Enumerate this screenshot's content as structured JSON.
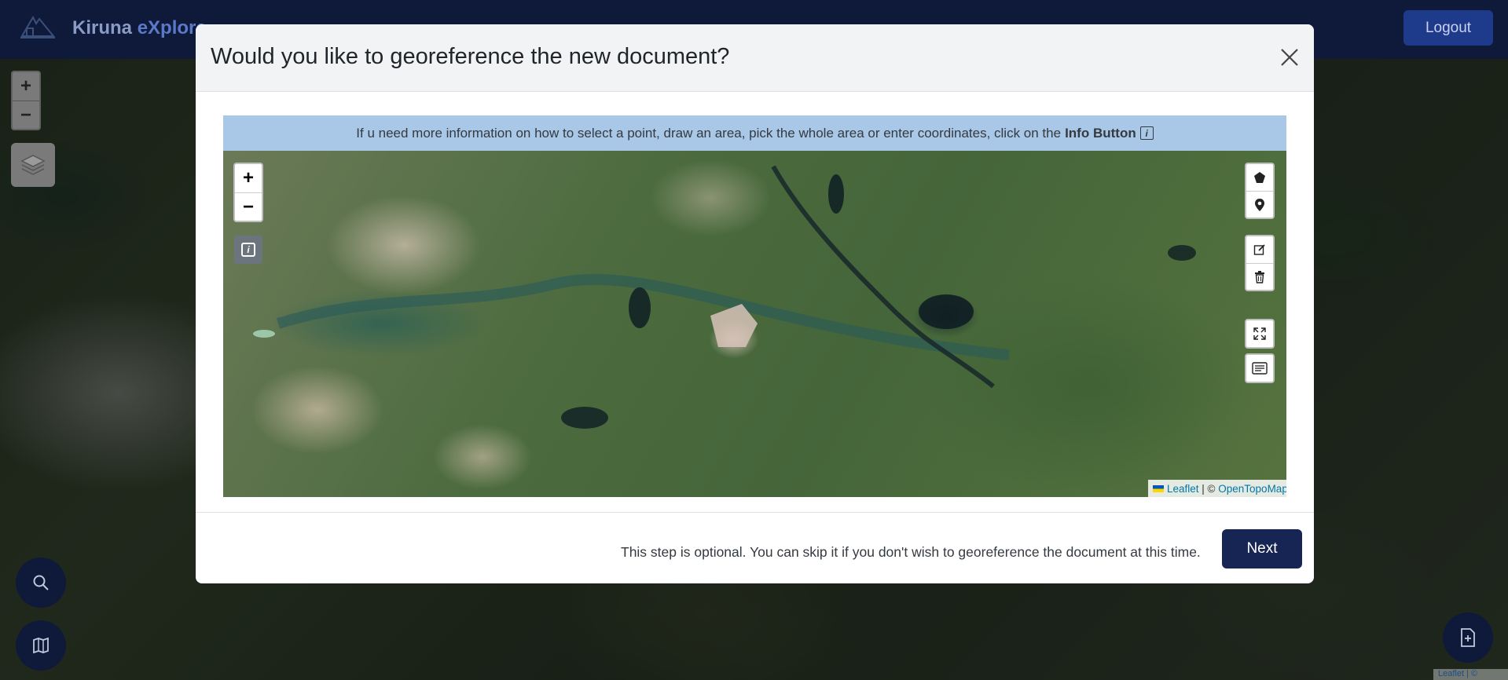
{
  "navbar": {
    "brand_part1": "Kiruna ",
    "brand_part2": "eXplore",
    "logout_label": "Logout"
  },
  "background_map": {
    "zoom_in_label": "+",
    "zoom_out_label": "−",
    "attribution": "Leaflet | ©"
  },
  "modal": {
    "title": "Would you like to georeference the new document?",
    "info_text": "If u need more information on how to select a point, draw an area, pick the whole area or enter coordinates, click on the",
    "info_bold": "Info Button",
    "info_icon_glyph": "i",
    "map": {
      "zoom_in_label": "+",
      "zoom_out_label": "−",
      "info_icon_glyph": "i",
      "attribution_leaflet": "Leaflet",
      "attribution_sep": " | © ",
      "attribution_source": "OpenTopoMap"
    },
    "footer_note": "This step is optional. You can skip it if you don't wish to georeference the document at this time.",
    "next_label": "Next"
  },
  "colors": {
    "navbar_bg": "#0f1a3a",
    "logout_bg": "#1e3a8a",
    "info_bar_bg": "#a9c7e6",
    "next_bg": "#172554"
  }
}
